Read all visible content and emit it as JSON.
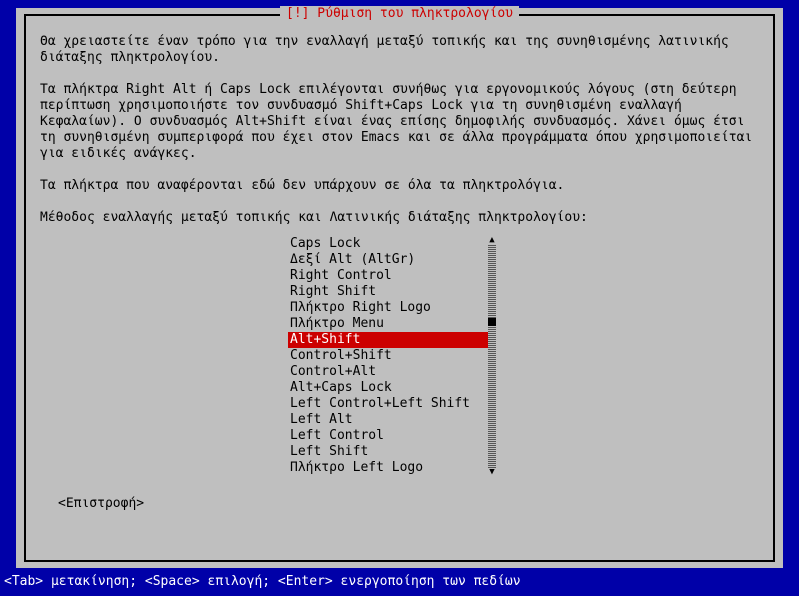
{
  "title": "[!] Ρύθμιση του πληκτρολογίου",
  "para1": "Θα χρειαστείτε έναν τρόπο για την εναλλαγή μεταξύ τοπικής και της συνηθισμένης λατινικής διάταξης πληκτρολογίου.",
  "para2": "Τα πλήκτρα Right Alt ή Caps Lock επιλέγονται συνήθως για εργονομικούς λόγους (στη δεύτερη περίπτωση χρησιμοποιήστε τον συνδυασμό Shift+Caps Lock για τη συνηθισμένη εναλλαγή Κεφαλαίων). Ο συνδυασμός Alt+Shift είναι ένας επίσης δημοφιλής συνδυασμός. Χάνει όμως έτσι τη συνηθισμένη συμπεριφορά που έχει στον Emacs και σε άλλα προγράμματα όπου χρησιμοποιείται για ειδικές ανάγκες.",
  "para3": "Τα πλήκτρα που αναφέρονται εδώ δεν υπάρχουν σε όλα τα πληκτρολόγια.",
  "prompt": "Μέθοδος εναλλαγής μεταξύ τοπικής και Λατινικής διάταξης πληκτρολογίου:",
  "options": [
    "Caps Lock",
    "Δεξί Alt (AltGr)",
    "Right Control",
    "Right Shift",
    "Πλήκτρο Right Logo",
    "Πλήκτρο Menu",
    "Alt+Shift",
    "Control+Shift",
    "Control+Alt",
    "Alt+Caps Lock",
    "Left Control+Left Shift",
    "Left Alt",
    "Left Control",
    "Left Shift",
    "Πλήκτρο Left Logo"
  ],
  "selected_index": 6,
  "back_label": "<Επιστροφή>",
  "footer": "<Tab> μετακίνηση; <Space> επιλογή; <Enter> ενεργοποίηση των πεδίων"
}
